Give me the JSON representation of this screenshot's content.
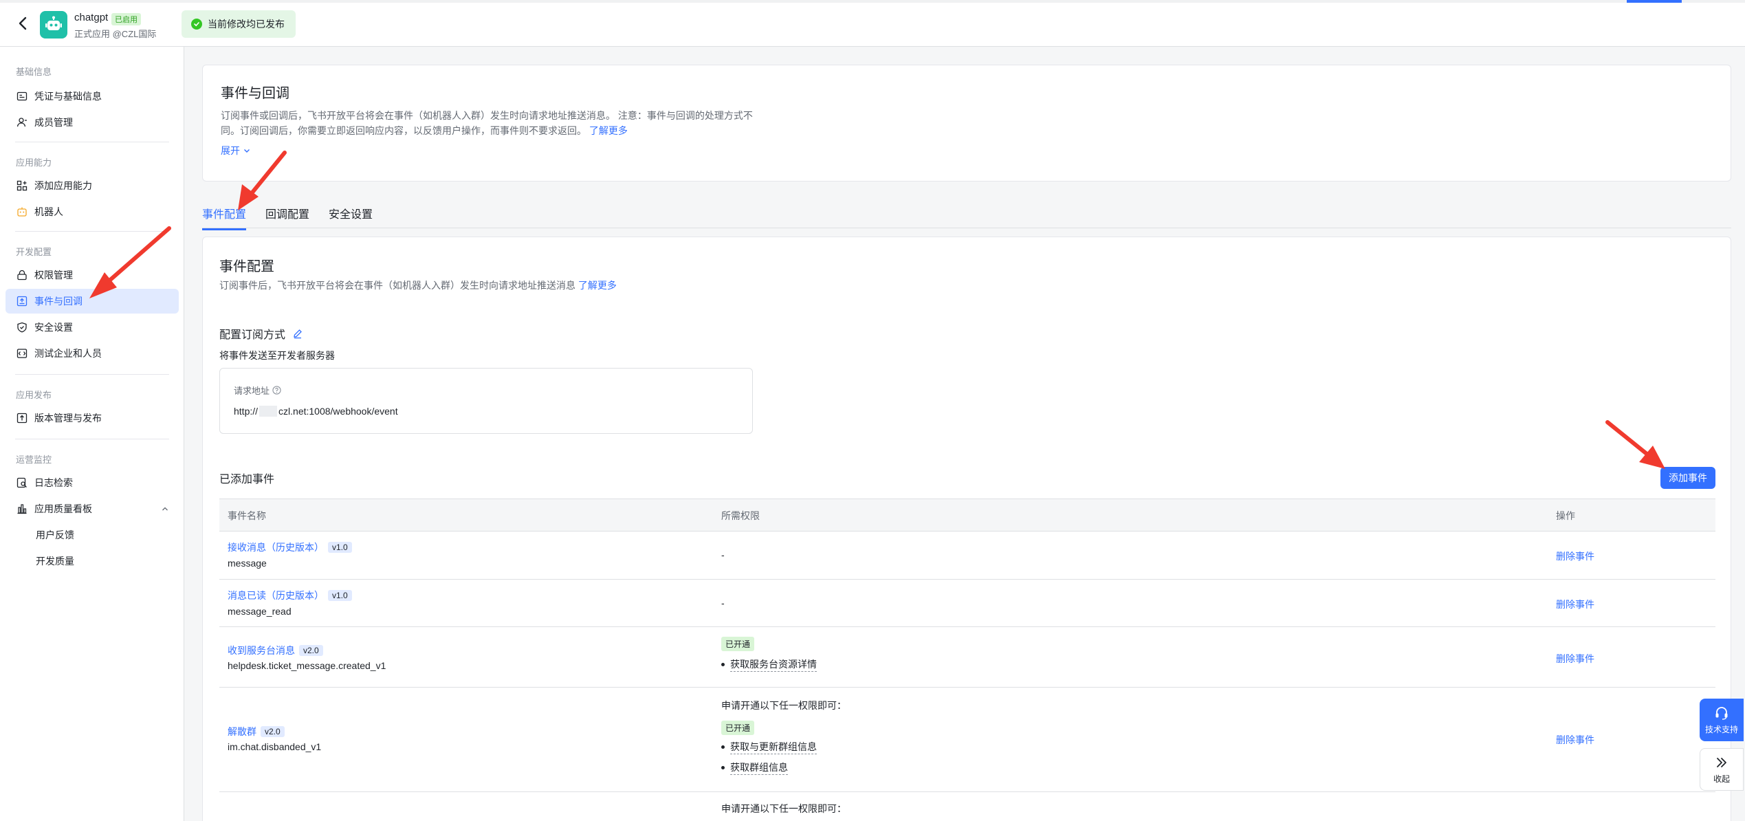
{
  "header": {
    "app_name": "chatgpt",
    "app_badge": "已启用",
    "app_sub": "正式应用 @CZL国际",
    "publish_status": "当前修改均已发布"
  },
  "sidebar": {
    "groups": [
      "基础信息",
      "应用能力",
      "开发配置",
      "应用发布",
      "运营监控"
    ],
    "items": [
      {
        "label": "凭证与基础信息",
        "icon": "credential-icon"
      },
      {
        "label": "成员管理",
        "icon": "member-icon"
      },
      {
        "label": "添加应用能力",
        "icon": "add-capability-icon"
      },
      {
        "label": "机器人",
        "icon": "robot-icon"
      },
      {
        "label": "权限管理",
        "icon": "permission-icon"
      },
      {
        "label": "事件与回调",
        "icon": "event-icon"
      },
      {
        "label": "安全设置",
        "icon": "shield-icon"
      },
      {
        "label": "测试企业和人员",
        "icon": "test-icon"
      },
      {
        "label": "版本管理与发布",
        "icon": "release-icon"
      },
      {
        "label": "日志检索",
        "icon": "log-search-icon"
      },
      {
        "label": "应用质量看板",
        "icon": "chart-icon"
      },
      {
        "label": "用户反馈",
        "icon": ""
      },
      {
        "label": "开发质量",
        "icon": ""
      }
    ]
  },
  "intro": {
    "title": "事件与回调",
    "desc": "订阅事件或回调后，飞书开放平台将会在事件（如机器人入群）发生时向请求地址推送消息。 注意：事件与回调的处理方式不同。订阅回调后，你需要立即返回响应内容，以反馈用户操作，而事件则不要求返回。",
    "learn_more": "了解更多",
    "expand": "展开"
  },
  "tabs": [
    "事件配置",
    "回调配置",
    "安全设置"
  ],
  "event_config": {
    "title": "事件配置",
    "desc": "订阅事件后，飞书开放平台将会在事件（如机器人入群）发生时向请求地址推送消息",
    "learn_more": "了解更多",
    "subscribe_title": "配置订阅方式",
    "subscribe_desc": "将事件发送至开发者服务器",
    "url_label": "请求地址",
    "url_prefix": "http://",
    "url_suffix": "czl.net:1008/webhook/event",
    "added_title": "已添加事件",
    "add_button": "添加事件"
  },
  "table": {
    "columns": [
      "事件名称",
      "所需权限",
      "操作"
    ],
    "rows": [
      {
        "name": "接收消息（历史版本）",
        "version": "v1.0",
        "key": "message",
        "perm": "-",
        "action": "删除事件"
      },
      {
        "name": "消息已读（历史版本）",
        "version": "v1.0",
        "key": "message_read",
        "perm": "-",
        "action": "删除事件"
      },
      {
        "name": "收到服务台消息",
        "version": "v2.0",
        "key": "helpdesk.ticket_message.created_v1",
        "badge": "已开通",
        "perms": [
          "获取服务台资源详情"
        ],
        "action": "删除事件"
      },
      {
        "name": "解散群",
        "version": "v2.0",
        "key": "im.chat.disbanded_v1",
        "hint": "申请开通以下任一权限即可：",
        "badge": "已开通",
        "perms": [
          "获取与更新群组信息",
          "获取群组信息"
        ],
        "action": "删除事件"
      },
      {
        "hint": "申请开通以下任一权限即可："
      }
    ]
  },
  "floating": {
    "support": "技术支持",
    "collapse": "收起"
  },
  "colors": {
    "primary": "#3370ff",
    "success_bg": "#e4f6e6",
    "annotation": "#f03a2e"
  }
}
